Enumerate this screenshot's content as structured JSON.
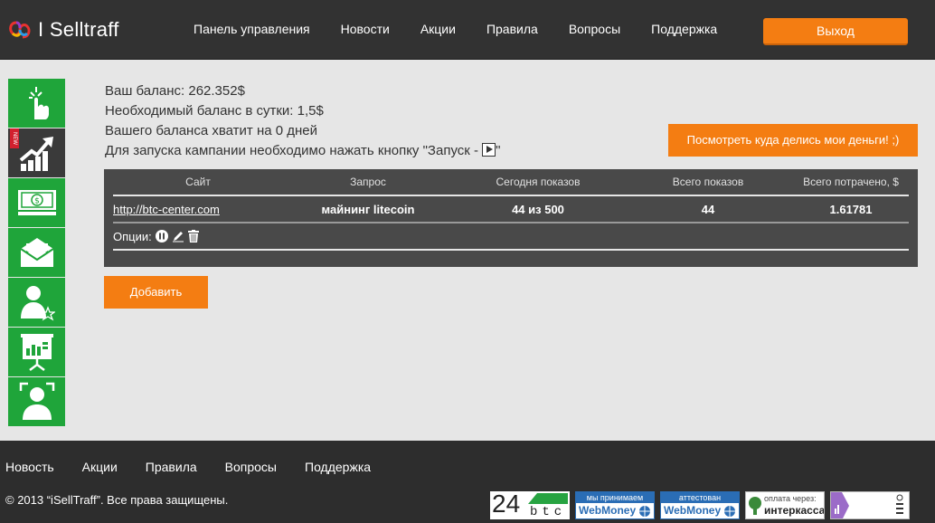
{
  "header": {
    "logo_text": "I Selltraff",
    "nav": [
      "Панель управления",
      "Новости",
      "Акции",
      "Правила",
      "Вопросы",
      "Поддержка"
    ],
    "logout_label": "Выход"
  },
  "sidebar": {
    "items": [
      {
        "icon": "touch-hand-icon"
      },
      {
        "icon": "growth-chart-icon",
        "badge": "NEW"
      },
      {
        "icon": "money-icon"
      },
      {
        "icon": "mail-icon"
      },
      {
        "icon": "user-star-icon"
      },
      {
        "icon": "presentation-icon"
      },
      {
        "icon": "user-focus-icon"
      }
    ]
  },
  "balance": {
    "line1": "Ваш баланс: 262.352$",
    "line2": "Необходимый баланс в сутки: 1,5$",
    "line3": "Вашего баланса хватит на 0 дней",
    "line4_prefix": "Для запуска кампании необходимо нажать кнопку \"Запуск - ",
    "line4_suffix": "\""
  },
  "money_button": "Посмотреть куда делись мои деньги! ;)",
  "table": {
    "headers": [
      "Сайт",
      "Запрос",
      "Сегодня показов",
      "Всего показов",
      "Всего потрачено, $"
    ],
    "rows": [
      [
        "http://btc-center.com",
        "майнинг litecoin",
        "44 из 500",
        "44",
        "1.61781"
      ]
    ],
    "options_label": "Опции:"
  },
  "add_button": "Добавить",
  "footer": {
    "nav": [
      "Новость",
      "Акции",
      "Правила",
      "Вопросы",
      "Поддержка"
    ],
    "copyright": "© 2013 “iSellTraff”. Все права защищены.",
    "badges": {
      "btc_number": "24",
      "btc_text": "btc",
      "wm1_top": "мы принимаем",
      "wm1_bottom": "WebMoney",
      "wm2_top": "аттестован",
      "wm2_bottom": "WebMoney",
      "ik_top": "оплата через:",
      "ik_bottom": "интеркасса"
    }
  },
  "colors": {
    "header_bg": "#323232",
    "accent_orange": "#f47d12",
    "sidebar_green": "#1fa53a",
    "panel_bg": "#494949",
    "page_bg": "#e6e6e6"
  }
}
